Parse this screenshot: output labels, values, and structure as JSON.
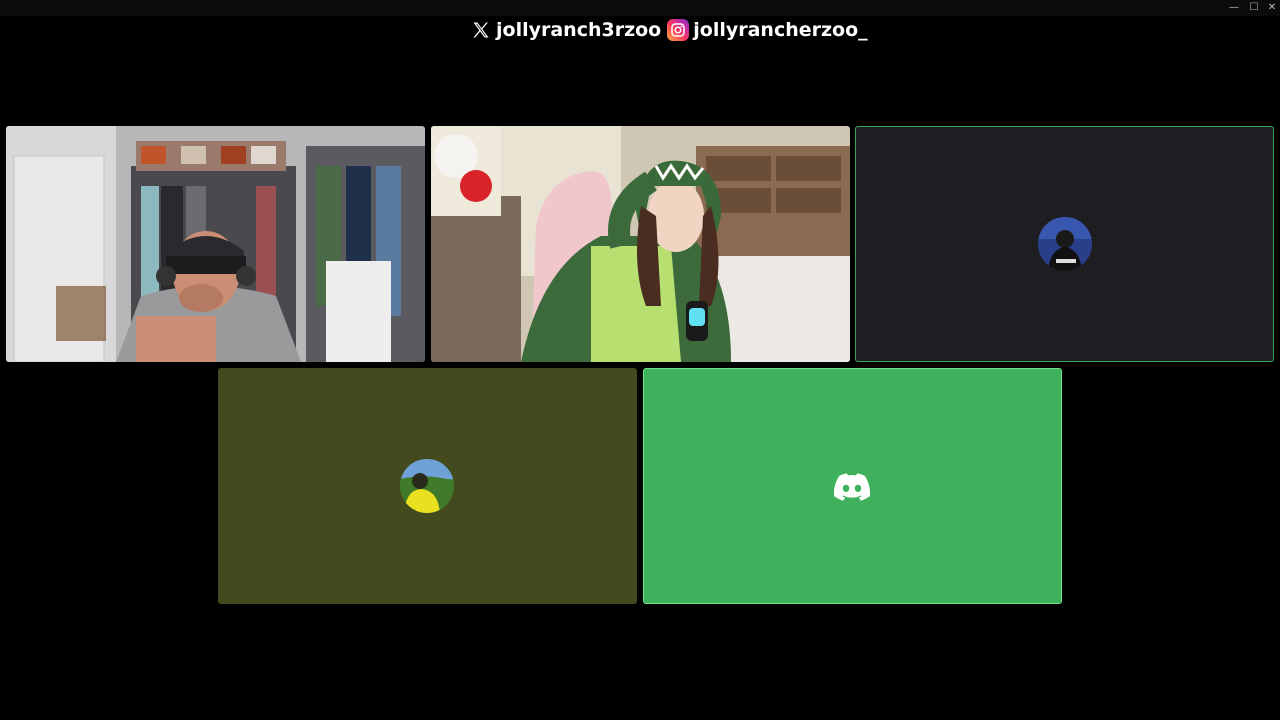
{
  "window": {
    "controls": {
      "minimize": "—",
      "maximize": "☐",
      "close": "✕"
    }
  },
  "socials": [
    {
      "platform_icon": "x-logo-icon",
      "handle": "jollyranch3rzoo"
    },
    {
      "platform_icon": "instagram-logo-icon",
      "handle": "jollyrancherzoo_"
    }
  ],
  "tiles": [
    {
      "type": "video",
      "description": "participant webcam video"
    },
    {
      "type": "video",
      "description": "participant webcam video"
    },
    {
      "type": "avatar",
      "speaking": true
    },
    {
      "type": "avatar",
      "speaking": false
    },
    {
      "type": "discord-logo",
      "speaking": true
    }
  ],
  "colors": {
    "background": "#000000",
    "speaking_border": "#3ba55c",
    "dark_tile": "#1e1d22",
    "olive_tile": "#434b1e",
    "green_tile": "#3fb05b"
  }
}
